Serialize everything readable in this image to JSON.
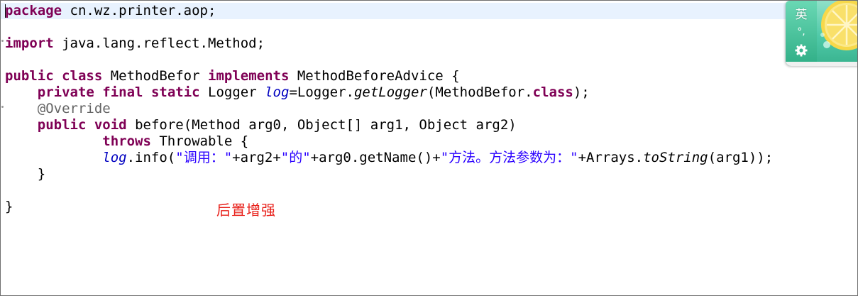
{
  "editor": {
    "line1": {
      "kw_package": "package",
      "rest": " cn.wz.printer.aop;"
    },
    "line3": {
      "kw_import": "import",
      "rest": " java.lang.reflect.Method;"
    },
    "line5": {
      "kw_public": "public",
      "sp1": " ",
      "kw_class": "class",
      "name": " MethodBefor ",
      "kw_implements": "implements",
      "rest": " MethodBeforeAdvice {"
    },
    "line6": {
      "indent": "    ",
      "kw_private": "private",
      "sp1": " ",
      "kw_final": "final",
      "sp2": " ",
      "kw_static": "static",
      "type": " Logger ",
      "field": "log",
      "assign": "=Logger.",
      "method": "getLogger",
      "args_open": "(MethodBefor.",
      "kw_class": "class",
      "close": ");"
    },
    "line7": {
      "indent": "    ",
      "annotation": "@Override"
    },
    "line8": {
      "indent": "    ",
      "kw_public": "public",
      "sp1": " ",
      "kw_void": "void",
      "rest": " before(Method arg0, Object[] arg1, Object arg2)"
    },
    "line9": {
      "indent": "            ",
      "kw_throws": "throws",
      "rest": " Throwable {"
    },
    "line10": {
      "indent": "            ",
      "field": "log",
      "call": ".info(",
      "str1": "\"调用：\"",
      "concat1": "+arg2+",
      "str2": "\"的\"",
      "concat2": "+arg0.getName()+",
      "str3": "\"方法。方法参数为：\"",
      "concat3": "+Arrays.",
      "method": "toString",
      "close": "(arg1));"
    },
    "line11": {
      "text": "    }"
    },
    "line13": {
      "text": "}"
    }
  },
  "annotation_note": "后置增强",
  "ime": {
    "mode_label": "英",
    "punct_label": "°,",
    "settings_icon": "gear-icon",
    "skin_icon": "lemon-icon",
    "accent_color": "#4fc9a8"
  },
  "colors": {
    "keyword": "#7f0055",
    "string": "#2a00ff",
    "static_field": "#0000c0",
    "annotation": "#646464",
    "note": "#e8201a",
    "current_line": "#e8f2fe"
  }
}
